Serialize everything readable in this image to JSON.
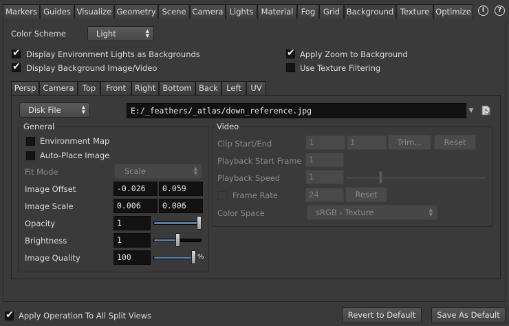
{
  "top_tabs": [
    "Markers",
    "Guides",
    "Visualize",
    "Geometry",
    "Scene",
    "Camera",
    "Lights",
    "Material",
    "Fog",
    "Grid",
    "Background",
    "Texture",
    "Optimize"
  ],
  "top_icons": {
    "info": "i",
    "help": "?"
  },
  "color_scheme": {
    "label": "Color Scheme",
    "value": "Light"
  },
  "options": {
    "env_lights": "Display Environment Lights as Backgrounds",
    "bg_image": "Display Background Image/Video",
    "apply_zoom": "Apply Zoom to Background",
    "texture_filter": "Use Texture Filtering"
  },
  "view_tabs": [
    "Persp",
    "Camera",
    "Top",
    "Front",
    "Right",
    "Bottom",
    "Back",
    "Left",
    "UV"
  ],
  "source": {
    "type": "Disk File",
    "path": "E:/_feathers/_atlas/down_reference.jpg"
  },
  "general": {
    "title": "General",
    "env_map": "Environment Map",
    "auto_place": "Auto-Place Image",
    "fit_mode_label": "Fit Mode",
    "fit_mode_value": "Scale",
    "offset_label": "Image Offset",
    "offset_x": "-0.026",
    "offset_y": "0.059",
    "scale_label": "Image Scale",
    "scale_x": "0.006",
    "scale_y": "0.006",
    "opacity_label": "Opacity",
    "opacity_value": "1",
    "brightness_label": "Brightness",
    "brightness_value": "1",
    "quality_label": "Image Quality",
    "quality_value": "100",
    "quality_unit": "%"
  },
  "sliders": {
    "opacity": 1.0,
    "brightness": 0.5,
    "quality": 1.0
  },
  "video": {
    "title": "Video",
    "clip_label": "Clip Start/End",
    "clip_start": "1",
    "clip_end": "1",
    "trim_label": "Trim...",
    "reset_label": "Reset",
    "playback_start_label": "Playback Start Frame",
    "playback_start": "1",
    "playback_speed_label": "Playback Speed",
    "playback_speed": "1",
    "frame_rate_label": "Frame Rate",
    "frame_rate": "24",
    "frame_reset_label": "Reset",
    "color_space_label": "Color Space",
    "color_space_value": "sRGB - Texture"
  },
  "footer": {
    "apply_all": "Apply Operation To All Split Views",
    "revert": "Revert to Default",
    "save": "Save As Default"
  }
}
